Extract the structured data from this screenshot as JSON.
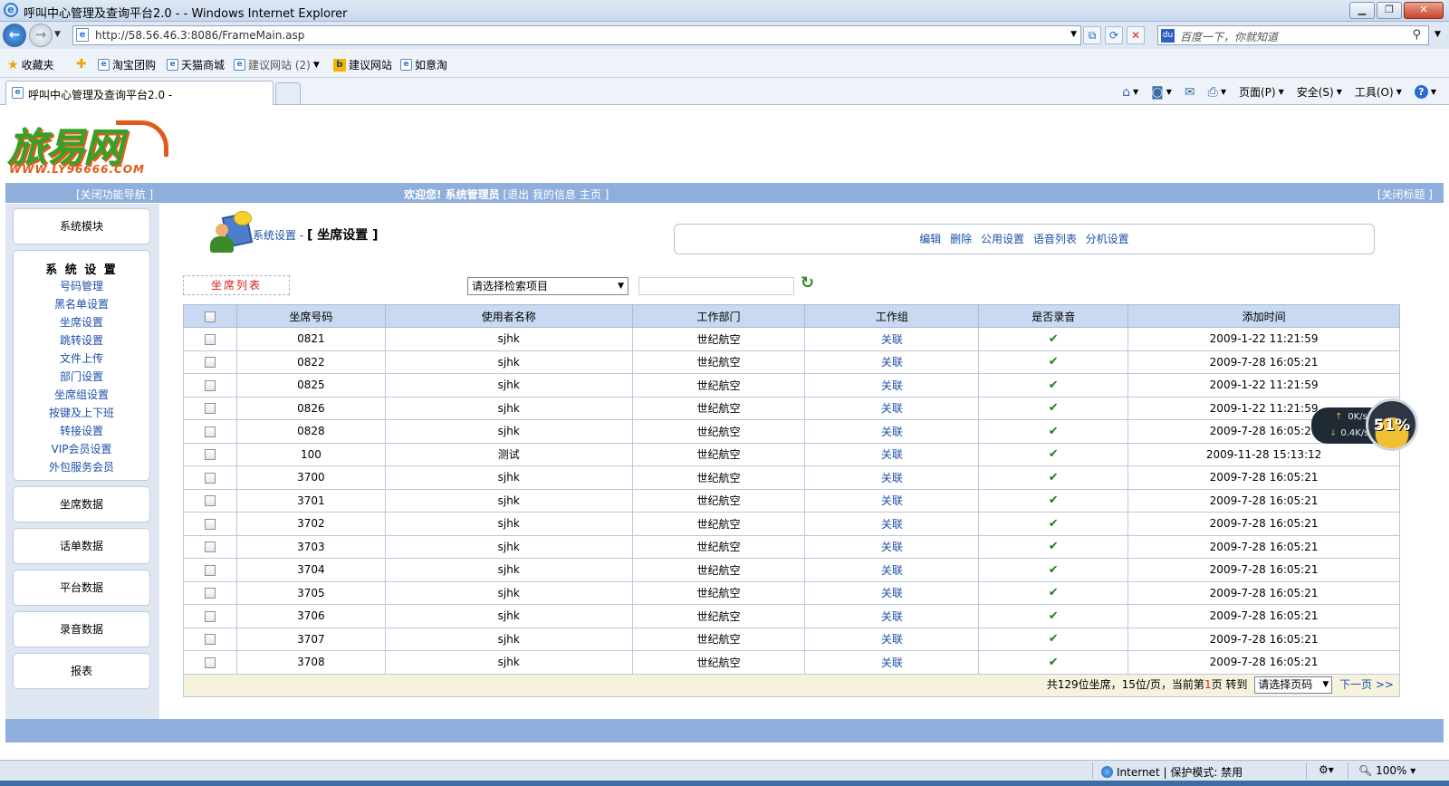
{
  "browser": {
    "window_title": "呼叫中心管理及查询平台2.0 -  - Windows Internet Explorer",
    "url": "http://58.56.46.3:8086/FrameMain.asp",
    "search_placeholder": "百度一下，你就知道",
    "favorites_label": "收藏夹",
    "favorites": [
      "淘宝团购",
      "天猫商城",
      "建议网站 (2)",
      "建议网站",
      "如意淘"
    ],
    "tab_title": "呼叫中心管理及查询平台2.0 -",
    "commands": {
      "page": "页面(P)",
      "safety": "安全(S)",
      "tools": "工具(O)"
    },
    "status_zone": "Internet | 保护模式: 禁用",
    "zoom": "100%"
  },
  "header": {
    "logo_text": "旅易网",
    "logo_url": "WWW.LY96666.COM",
    "close_nav": "[关闭功能导航 ]",
    "welcome": "欢迎您! 系统管理员",
    "logout": "[退出",
    "my_info": "我的信息",
    "home": "主页 ]",
    "close_title": "[关闭标题 ]"
  },
  "sidebar": {
    "system_module": "系统模块",
    "settings_title": "系 统 设 置",
    "settings_links": [
      "号码管理",
      "黑名单设置",
      "坐席设置",
      "跳转设置",
      "文件上传",
      "部门设置",
      "坐席组设置",
      "按键及上下班",
      "转接设置",
      "VIP会员设置",
      "外包服务会员"
    ],
    "agent_data": "坐席数据",
    "call_data": "话单数据",
    "platform_data": "平台数据",
    "recording_data": "录音数据",
    "reports": "报表"
  },
  "main": {
    "breadcrumb_parent": "系统设置 -",
    "breadcrumb_current": "[ 坐席设置 ]",
    "actions": {
      "edit": "编辑",
      "delete": "删除",
      "public_settings": "公用设置",
      "voice_list": "语音列表",
      "extension_settings": "分机设置"
    },
    "list_tab": "坐席列表",
    "search_select": "请选择检索项目",
    "columns": [
      "坐席号码",
      "使用者名称",
      "工作部门",
      "工作组",
      "是否录音",
      "添加时间"
    ],
    "rows": [
      {
        "number": "0821",
        "user": "sjhk",
        "dept": "世纪航空",
        "group": "关联",
        "time": "2009-1-22 11:21:59"
      },
      {
        "number": "0822",
        "user": "sjhk",
        "dept": "世纪航空",
        "group": "关联",
        "time": "2009-7-28 16:05:21"
      },
      {
        "number": "0825",
        "user": "sjhk",
        "dept": "世纪航空",
        "group": "关联",
        "time": "2009-1-22 11:21:59"
      },
      {
        "number": "0826",
        "user": "sjhk",
        "dept": "世纪航空",
        "group": "关联",
        "time": "2009-1-22 11:21:59"
      },
      {
        "number": "0828",
        "user": "sjhk",
        "dept": "世纪航空",
        "group": "关联",
        "time": "2009-7-28 16:05:21"
      },
      {
        "number": "100",
        "user": "测试",
        "dept": "世纪航空",
        "group": "关联",
        "time": "2009-11-28 15:13:12"
      },
      {
        "number": "3700",
        "user": "sjhk",
        "dept": "世纪航空",
        "group": "关联",
        "time": "2009-7-28 16:05:21"
      },
      {
        "number": "3701",
        "user": "sjhk",
        "dept": "世纪航空",
        "group": "关联",
        "time": "2009-7-28 16:05:21"
      },
      {
        "number": "3702",
        "user": "sjhk",
        "dept": "世纪航空",
        "group": "关联",
        "time": "2009-7-28 16:05:21"
      },
      {
        "number": "3703",
        "user": "sjhk",
        "dept": "世纪航空",
        "group": "关联",
        "time": "2009-7-28 16:05:21"
      },
      {
        "number": "3704",
        "user": "sjhk",
        "dept": "世纪航空",
        "group": "关联",
        "time": "2009-7-28 16:05:21"
      },
      {
        "number": "3705",
        "user": "sjhk",
        "dept": "世纪航空",
        "group": "关联",
        "time": "2009-7-28 16:05:21"
      },
      {
        "number": "3706",
        "user": "sjhk",
        "dept": "世纪航空",
        "group": "关联",
        "time": "2009-7-28 16:05:21"
      },
      {
        "number": "3707",
        "user": "sjhk",
        "dept": "世纪航空",
        "group": "关联",
        "time": "2009-7-28 16:05:21"
      },
      {
        "number": "3708",
        "user": "sjhk",
        "dept": "世纪航空",
        "group": "关联",
        "time": "2009-7-28 16:05:21"
      }
    ],
    "pagination": {
      "summary_pre": "共129位坐席，15位/页，当前第",
      "current": "1",
      "summary_post": "页  转到",
      "page_select": "请选择页码",
      "next": "下一页 >>"
    }
  },
  "net_meter": {
    "up": "0K/s",
    "down": "0.4K/s",
    "percent": "51%"
  },
  "icons": {
    "checked": "✔",
    "check_color": "#1f7a1f",
    "accent_blue": "#8eaedc",
    "header_blue": "#c8d9f1",
    "link_blue": "#1d4fa8",
    "highlight_red": "#d81c1c"
  }
}
